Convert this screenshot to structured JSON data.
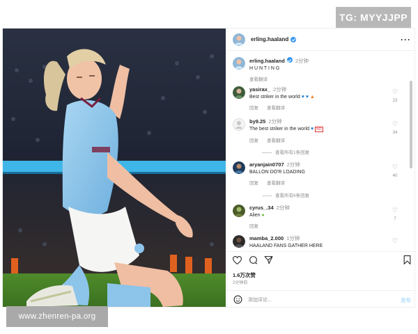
{
  "watermarks": {
    "top_right": "TG: MYYJJPP",
    "bottom_left": "www.zhenren-pa.org"
  },
  "post": {
    "author": "erling.haaland",
    "caption_author": "erling.haaland",
    "caption_time": "2分钟",
    "caption_text": "H U N T I N G",
    "reply_label": "回复",
    "translate_label": "查看翻译",
    "likes_count": "1.6万次赞",
    "time_ago": "2分钟前",
    "comment_placeholder": "添加评论...",
    "post_button": "发布",
    "more_icon": "···"
  },
  "comments": [
    {
      "user": "yasirax_",
      "time": "2分钟",
      "text": "Best striker in the world",
      "emoji": "blue-hearts-fire",
      "likes": "23",
      "reply": "回复",
      "translate": "查看翻译",
      "view_all": ""
    },
    {
      "user": "by9.25",
      "time": "2分钟",
      "text": "The best striker in the world",
      "emoji": "blue-heart-no",
      "likes": "34",
      "reply": "回复",
      "translate": "查看翻译",
      "view_all": "查看所有1条回复"
    },
    {
      "user": "aryanjain0707",
      "time": "2分钟",
      "text": "BALLON DO'R LOADING",
      "emoji": "",
      "likes": "40",
      "reply": "回复",
      "translate": "查看翻译",
      "view_all": "查看所有6条回复"
    },
    {
      "user": "cyrus_.34",
      "time": "2分钟",
      "text": "Alien",
      "emoji": "alien",
      "likes": "7",
      "reply": "回复",
      "translate": "",
      "view_all": ""
    },
    {
      "user": "mamba_2.000",
      "time": "1分钟",
      "text": "HAALAND FANS GATHER HERE",
      "emoji": "",
      "likes": "",
      "reply": "",
      "translate": "",
      "view_all": ""
    }
  ],
  "icons": [
    "heart-icon",
    "comment-icon",
    "share-icon",
    "bookmark-icon",
    "emoji-icon",
    "verified-badge-icon"
  ],
  "colors": {
    "link_blue": "#3897f0",
    "muted": "#8e8e8e",
    "post_button": "#b2dffc",
    "city_blue": "#8dc4ea"
  }
}
